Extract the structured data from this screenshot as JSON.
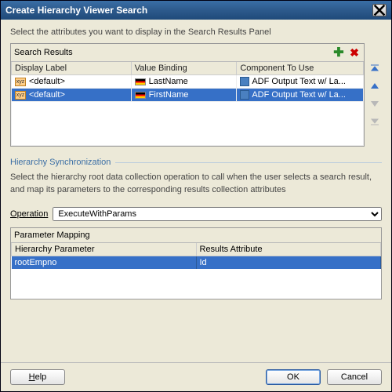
{
  "title": "Create Hierarchy Viewer Search",
  "intro": "Select the attributes you want to display in the Search Results Panel",
  "searchResults": {
    "label": "Search Results",
    "columns": {
      "c1": "Display Label",
      "c2": "Value Binding",
      "c3": "Component To Use"
    },
    "rows": [
      {
        "display": "<default>",
        "binding": "LastName",
        "component": "ADF Output Text w/ La..."
      },
      {
        "display": "<default>",
        "binding": "FirstName",
        "component": "ADF Output Text w/ La..."
      }
    ]
  },
  "syncSection": {
    "heading": "Hierarchy Synchronization",
    "hint": "Select the hierarchy root data collection operation to call when the user selects a search result, and map its parameters to the corresponding results collection attributes",
    "operationLabel": "peration",
    "operationUnderline": "O",
    "operationValue": "ExecuteWithParams",
    "paramMapping": {
      "label": "Parameter Mapping",
      "columns": {
        "c1": "Hierarchy Parameter",
        "c2": "Results Attribute"
      },
      "row": {
        "param": "rootEmpno",
        "attr": "Id"
      }
    }
  },
  "buttons": {
    "help": "elp",
    "helpUnderline": "H",
    "ok": "OK",
    "cancel": "Cancel"
  },
  "icons": {
    "add": "✚",
    "del": "✖"
  }
}
